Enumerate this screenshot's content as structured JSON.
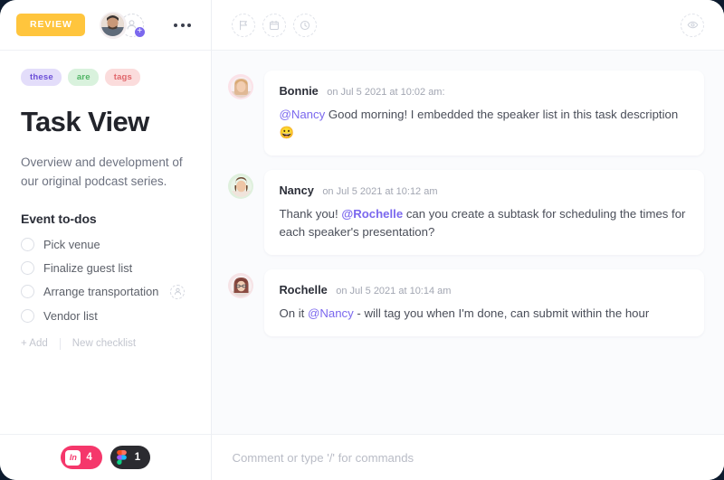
{
  "left_panel": {
    "header": {
      "review_label": "REVIEW",
      "assignee_avatar": "user-avatar",
      "add_assignee_label": "+",
      "more_menu": "more-options"
    },
    "tags": [
      {
        "label": "these",
        "color": "#6c4fd8"
      },
      {
        "label": "are",
        "color": "#4fb464"
      },
      {
        "label": "tags",
        "color": "#e0656a"
      }
    ],
    "title": "Task View",
    "description": "Overview and development of our original podcast series.",
    "checklist": {
      "title": "Event to-dos",
      "items": [
        {
          "label": "Pick venue",
          "checked": false,
          "has_assignee": false
        },
        {
          "label": "Finalize guest list",
          "checked": false,
          "has_assignee": false
        },
        {
          "label": "Arrange transportation",
          "checked": false,
          "has_assignee": true
        },
        {
          "label": "Vendor list",
          "checked": false,
          "has_assignee": false
        }
      ],
      "add_label": "+ Add",
      "new_checklist_label": "New checklist"
    },
    "integrations": [
      {
        "name": "InVision",
        "short": "In",
        "count": "4",
        "color": "#f5376b"
      },
      {
        "name": "Figma",
        "short": "Figma",
        "count": "1",
        "color": "#2b2b30"
      }
    ]
  },
  "right_panel": {
    "header_icons": [
      "flag-icon",
      "calendar-icon",
      "clock-icon",
      "eye-icon"
    ],
    "comments": [
      {
        "author": "Bonnie",
        "time": "on Jul 5 2021 at 10:02 am:",
        "mention": "@Nancy",
        "mention_bold": false,
        "text_before": "",
        "text_after": " Good morning! I embedded the speaker list in this task description 😀",
        "avatar_ring": "#fbe2e8"
      },
      {
        "author": "Nancy",
        "time": "on Jul 5 2021 at 10:12 am",
        "mention": "@Rochelle",
        "mention_bold": true,
        "text_before": "Thank you! ",
        "text_after": " can you create a subtask for scheduling the times for each speaker's presentation?",
        "avatar_ring": "#dff0dd"
      },
      {
        "author": "Rochelle",
        "time": "on Jul 5 2021 at 10:14 am",
        "mention": "@Nancy",
        "mention_bold": false,
        "text_before": "On it ",
        "text_after": " - will tag you when I'm done, can submit within the hour",
        "avatar_ring": "#f6e3e6"
      }
    ],
    "composer_placeholder": "Comment or type '/' for commands"
  }
}
